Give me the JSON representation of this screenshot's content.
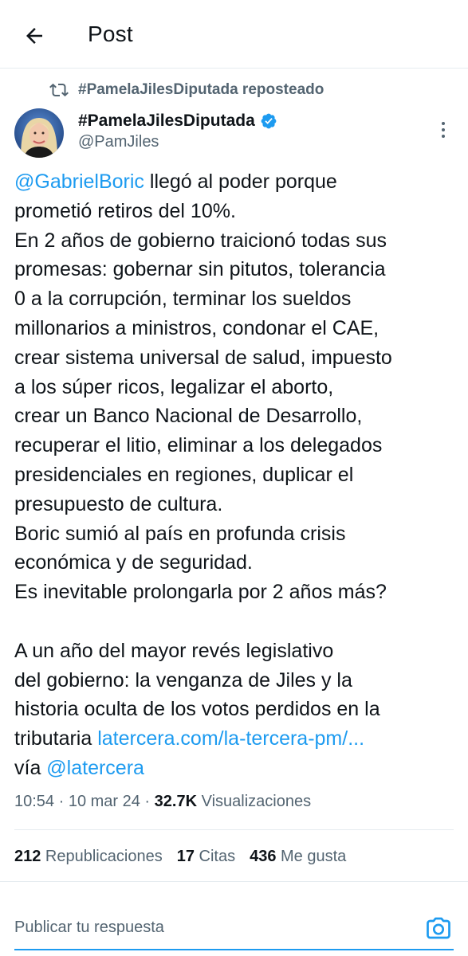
{
  "header": {
    "title": "Post"
  },
  "repost": {
    "text": "#PamelaJilesDiputada reposteado"
  },
  "author": {
    "name": "#PamelaJilesDiputada",
    "handle": "@PamJiles"
  },
  "tweet": {
    "mention": "@GabrielBoric",
    "p1": " llegó al poder porque\nprometió retiros del 10%.\nEn 2 años de gobierno traicionó todas sus\npromesas: gobernar sin pitutos, tolerancia\n0 a la corrupción, terminar los sueldos\nmillonarios a ministros, condonar el CAE,\ncrear sistema universal de salud, impuesto\na los súper ricos, legalizar el aborto,\ncrear un Banco Nacional de Desarrollo,\nrecuperar el litio, eliminar a los delegados\npresidenciales en regiones, duplicar el\npresupuesto de cultura.\nBoric sumió al país en profunda crisis\neconómica y de seguridad.\nEs inevitable prolongarla por 2 años más?\n\nA un año del mayor revés legislativo\ndel gobierno: la venganza de Jiles y la\nhistoria oculta de los votos perdidos en la\ntributaria ",
    "link": "latercera.com/la-tercera-pm/...",
    "p2": "\nvía ",
    "mention2": "@latercera"
  },
  "meta": {
    "time": "10:54 · 10 mar 24 · ",
    "views_count": "32.7K",
    "views_label": " Visualizaciones"
  },
  "stats": {
    "reposts_count": "212",
    "reposts_label": " Republicaciones",
    "quotes_count": "17",
    "quotes_label": " Citas",
    "likes_count": "436",
    "likes_label": " Me gusta"
  },
  "reply": {
    "placeholder": "Publicar tu respuesta"
  },
  "colors": {
    "accent": "#1d9bf0",
    "muted": "#536471",
    "text": "#0f1419",
    "divider": "#e6ecf0"
  }
}
